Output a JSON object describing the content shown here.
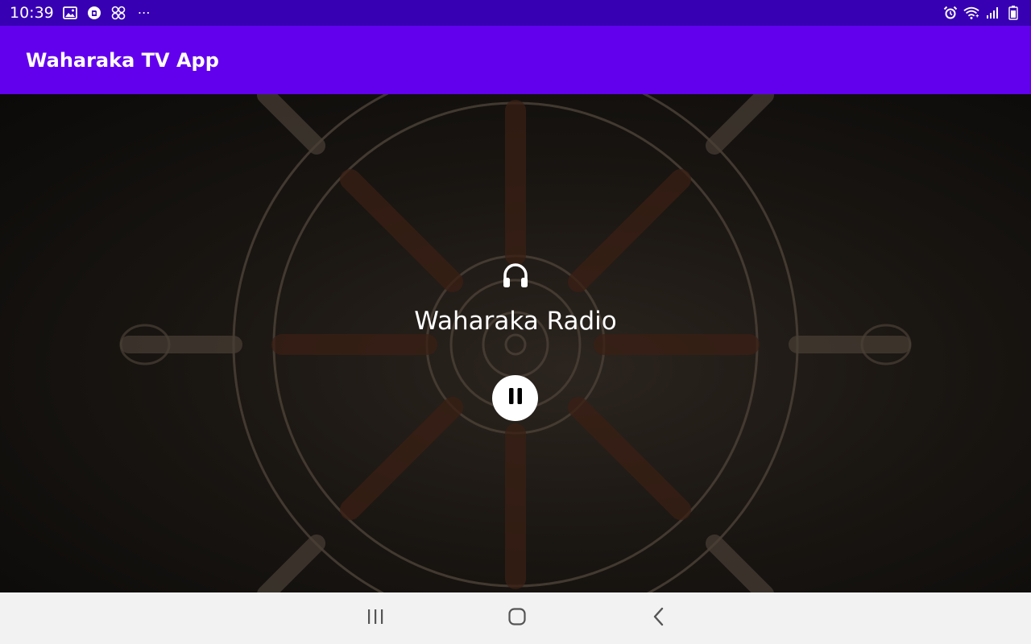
{
  "status_bar": {
    "time": "10:39",
    "more": "⋯",
    "left_icons": [
      "gallery-icon",
      "app-notification-icon",
      "shortcut-icon"
    ],
    "right_icons": [
      "alarm-icon",
      "wifi-icon",
      "signal-icon",
      "battery-icon"
    ]
  },
  "app_bar": {
    "title": "Waharaka TV App"
  },
  "player": {
    "icon": "headphones-icon",
    "station_name": "Waharaka Radio",
    "state": "playing",
    "control_icon": "pause-icon"
  },
  "nav_bar": {
    "buttons": [
      "recent-apps-icon",
      "home-icon",
      "back-icon"
    ]
  },
  "colors": {
    "status_bar": "#3700b3",
    "app_bar": "#6200ee",
    "nav_bar": "#f2f2f2"
  }
}
